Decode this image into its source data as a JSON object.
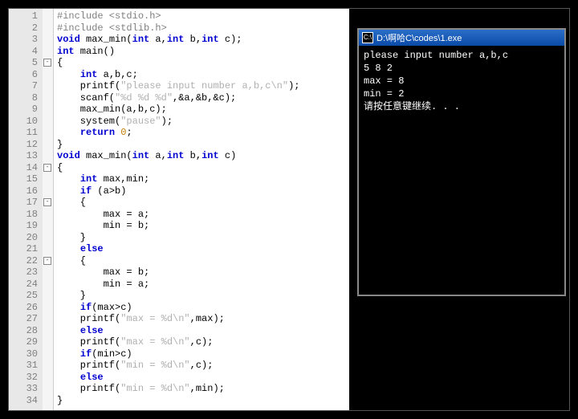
{
  "editor": {
    "lines": [
      {
        "n": 1,
        "seg": [
          {
            "t": "#include <stdio.h>",
            "c": "pp"
          }
        ]
      },
      {
        "n": 2,
        "seg": [
          {
            "t": "#include <stdlib.h>",
            "c": "pp"
          }
        ]
      },
      {
        "n": 3,
        "seg": [
          {
            "t": "void",
            "c": "kw"
          },
          {
            "t": " max_min("
          },
          {
            "t": "int",
            "c": "kw"
          },
          {
            "t": " a,"
          },
          {
            "t": "int",
            "c": "kw"
          },
          {
            "t": " b,"
          },
          {
            "t": "int",
            "c": "kw"
          },
          {
            "t": " c);"
          }
        ]
      },
      {
        "n": 4,
        "seg": [
          {
            "t": "int",
            "c": "kw"
          },
          {
            "t": " main()"
          }
        ]
      },
      {
        "n": 5,
        "seg": [
          {
            "t": "{"
          }
        ],
        "fold": true
      },
      {
        "n": 6,
        "seg": [
          {
            "t": "    "
          },
          {
            "t": "int",
            "c": "kw"
          },
          {
            "t": " a,b,c;"
          }
        ]
      },
      {
        "n": 7,
        "seg": [
          {
            "t": "    printf("
          },
          {
            "t": "\"please input number a,b,c\\n\"",
            "c": "str"
          },
          {
            "t": ");"
          }
        ]
      },
      {
        "n": 8,
        "seg": [
          {
            "t": "    scanf("
          },
          {
            "t": "\"%d %d %d\"",
            "c": "str"
          },
          {
            "t": ",&a,&b,&c);"
          }
        ]
      },
      {
        "n": 9,
        "seg": [
          {
            "t": "    max_min(a,b,c);"
          }
        ]
      },
      {
        "n": 10,
        "seg": [
          {
            "t": "    system("
          },
          {
            "t": "\"pause\"",
            "c": "str"
          },
          {
            "t": ");"
          }
        ]
      },
      {
        "n": 11,
        "seg": [
          {
            "t": "    "
          },
          {
            "t": "return",
            "c": "kw"
          },
          {
            "t": " "
          },
          {
            "t": "0",
            "c": "num"
          },
          {
            "t": ";"
          }
        ]
      },
      {
        "n": 12,
        "seg": [
          {
            "t": "}"
          }
        ]
      },
      {
        "n": 13,
        "seg": [
          {
            "t": "void",
            "c": "kw"
          },
          {
            "t": " max_min("
          },
          {
            "t": "int",
            "c": "kw"
          },
          {
            "t": " a,"
          },
          {
            "t": "int",
            "c": "kw"
          },
          {
            "t": " b,"
          },
          {
            "t": "int",
            "c": "kw"
          },
          {
            "t": " c)"
          }
        ]
      },
      {
        "n": 14,
        "seg": [
          {
            "t": "{"
          }
        ],
        "fold": true
      },
      {
        "n": 15,
        "seg": [
          {
            "t": "    "
          },
          {
            "t": "int",
            "c": "kw"
          },
          {
            "t": " max,min;"
          }
        ]
      },
      {
        "n": 16,
        "seg": [
          {
            "t": "    "
          },
          {
            "t": "if",
            "c": "kw"
          },
          {
            "t": " (a>b)"
          }
        ]
      },
      {
        "n": 17,
        "seg": [
          {
            "t": "    {"
          }
        ],
        "fold": true
      },
      {
        "n": 18,
        "seg": [
          {
            "t": "        max = a;"
          }
        ]
      },
      {
        "n": 19,
        "seg": [
          {
            "t": "        min = b;"
          }
        ]
      },
      {
        "n": 20,
        "seg": [
          {
            "t": "    }"
          }
        ]
      },
      {
        "n": 21,
        "seg": [
          {
            "t": "    "
          },
          {
            "t": "else",
            "c": "kw"
          }
        ]
      },
      {
        "n": 22,
        "seg": [
          {
            "t": "    {"
          }
        ],
        "fold": true
      },
      {
        "n": 23,
        "seg": [
          {
            "t": "        max = b;"
          }
        ]
      },
      {
        "n": 24,
        "seg": [
          {
            "t": "        min = a;"
          }
        ]
      },
      {
        "n": 25,
        "seg": [
          {
            "t": "    }"
          }
        ]
      },
      {
        "n": 26,
        "seg": [
          {
            "t": "    "
          },
          {
            "t": "if",
            "c": "kw"
          },
          {
            "t": "(max>c)"
          }
        ]
      },
      {
        "n": 27,
        "seg": [
          {
            "t": "    printf("
          },
          {
            "t": "\"max = %d\\n\"",
            "c": "str"
          },
          {
            "t": ",max);"
          }
        ]
      },
      {
        "n": 28,
        "seg": [
          {
            "t": "    "
          },
          {
            "t": "else",
            "c": "kw"
          }
        ]
      },
      {
        "n": 29,
        "seg": [
          {
            "t": "    printf("
          },
          {
            "t": "\"max = %d\\n\"",
            "c": "str"
          },
          {
            "t": ",c);"
          }
        ]
      },
      {
        "n": 30,
        "seg": [
          {
            "t": "    "
          },
          {
            "t": "if",
            "c": "kw"
          },
          {
            "t": "(min>c)"
          }
        ]
      },
      {
        "n": 31,
        "seg": [
          {
            "t": "    printf("
          },
          {
            "t": "\"min = %d\\n\"",
            "c": "str"
          },
          {
            "t": ",c);"
          }
        ]
      },
      {
        "n": 32,
        "seg": [
          {
            "t": "    "
          },
          {
            "t": "else",
            "c": "kw"
          }
        ]
      },
      {
        "n": 33,
        "seg": [
          {
            "t": "    printf("
          },
          {
            "t": "\"min = %d\\n\"",
            "c": "str"
          },
          {
            "t": ",min);"
          }
        ]
      },
      {
        "n": 34,
        "seg": [
          {
            "t": "}"
          }
        ]
      }
    ]
  },
  "console": {
    "icon": "C:\\",
    "title": "D:\\啊哈C\\codes\\1.exe",
    "out": [
      "please input number a,b,c",
      "5 8 2",
      "max = 8",
      "min = 2",
      "请按任意键继续. . ."
    ]
  }
}
